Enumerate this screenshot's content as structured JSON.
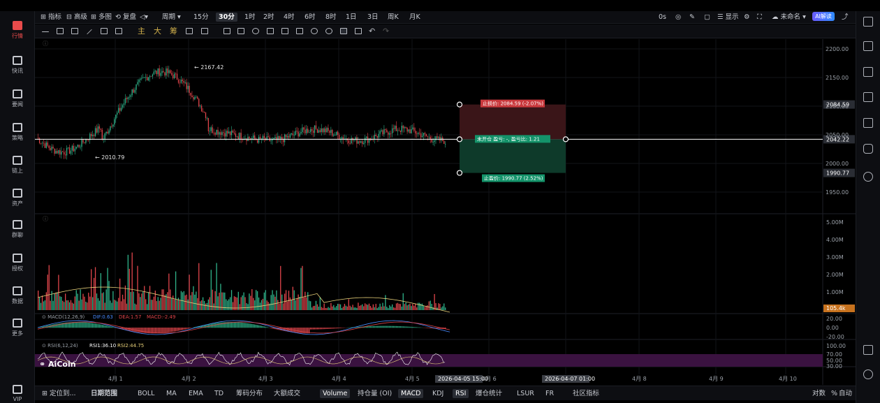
{
  "nav": {
    "items": [
      {
        "label": "行情",
        "icon": "chart-bars-icon",
        "active": true
      },
      {
        "label": "快讯",
        "icon": "news-icon"
      },
      {
        "label": "要闻",
        "icon": "document-icon"
      },
      {
        "label": "策略",
        "icon": "robot-icon"
      },
      {
        "label": "链上",
        "icon": "chain-icon"
      },
      {
        "label": "资产",
        "icon": "wallet-icon"
      },
      {
        "label": "群聊",
        "icon": "chat-icon"
      },
      {
        "label": "授权",
        "icon": "license-icon"
      },
      {
        "label": "数据",
        "icon": "data-icon"
      },
      {
        "label": "更多",
        "icon": "more-icon"
      },
      {
        "label": "VIP",
        "icon": "vip-icon"
      }
    ]
  },
  "toolbar": {
    "indicators": "指标",
    "advanced": "高级",
    "multi": "多图",
    "replay": "复盘",
    "period_label": "周期",
    "periods": [
      "15分",
      "30分",
      "1时",
      "2时",
      "4时",
      "6时",
      "8时",
      "1日",
      "3日",
      "周K",
      "月K"
    ],
    "active_period": "30分",
    "countdown": "0s",
    "display": "显示",
    "layout_name": "未命名",
    "ai_label": "AI解读"
  },
  "drawing_tools": {
    "main": "主",
    "big": "大",
    "chips": "筹"
  },
  "chart_data": {
    "type": "candlestick",
    "price_axis": [
      "2200.00",
      "2150.00",
      "2100.00",
      "2050.00",
      "2000.00",
      "1950.00"
    ],
    "current_price": "2042.22",
    "high_label": "2167.42",
    "low_label": "2010.79",
    "stop_loss_price": "2084.59",
    "take_profit_price": "1990.77",
    "stop_loss_text": "止损价: 2084.59 (-2.07%)",
    "take_profit_text": "止盈价: 1990.77 (2.52%)",
    "position_text": "未开仓 盈亏: -, 盈亏比: 1.21",
    "volume_axis": [
      "5.00M",
      "4.00M",
      "3.00M",
      "2.00M",
      "1.00M"
    ],
    "current_volume": "105.4k",
    "macd_label": "MACD(12,26,9)",
    "macd_dif": "DIF:0.63",
    "macd_dea": "DEA:1.57",
    "macd_val": "MACD:-2.49",
    "macd_axis": [
      "20.00",
      "0.00",
      "-20.00"
    ],
    "rsi_label": "RSI(6,12,24)",
    "rsi1": "RSI1:36.10",
    "rsi2": "RSI2:44.75",
    "rsi_axis": [
      "100.00",
      "70.00",
      "50.00",
      "30.00"
    ],
    "x_labels": [
      "4月 1",
      "4月 2",
      "4月 3",
      "4月 4",
      "4月 5",
      "4月 6",
      "4月 8",
      "4月 9",
      "4月 10"
    ],
    "crosshair_times": [
      "2026-04-05 15:00",
      "2026-04-07 01:00"
    ],
    "watermark": "AiCoin"
  },
  "bottom": {
    "locate": "定位到...",
    "date_range": "日期范围",
    "tabs": [
      "BOLL",
      "MA",
      "EMA",
      "TD",
      "筹码分布",
      "大额成交",
      "Volume",
      "持仓量 (OI)",
      "MACD",
      "KDJ",
      "RSI",
      "爆仓统计",
      "LSUR",
      "FR",
      "社区指标"
    ],
    "active": [
      "Volume",
      "MACD",
      "RSI"
    ],
    "log": "对数",
    "percent": "%",
    "auto": "自动"
  }
}
